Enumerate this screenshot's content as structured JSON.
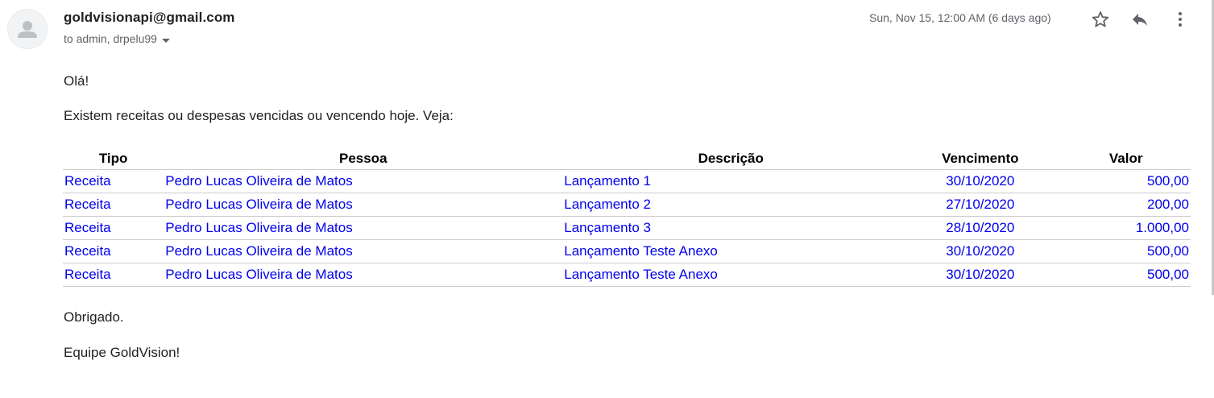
{
  "email": {
    "sender": "goldvisionapi@gmail.com",
    "recipients": "to admin, drpelu99",
    "date": "Sun, Nov 15, 12:00 AM (6 days ago)",
    "icons": {
      "avatar": "person-avatar-icon",
      "star": "star-outline-icon",
      "reply": "reply-icon",
      "more": "more-vertical-icon",
      "caret": "caret-down-icon"
    }
  },
  "body": {
    "greeting": "Olá!",
    "intro": "Existem receitas ou despesas vencidas ou vencendo hoje. Veja:",
    "thanks": "Obrigado.",
    "signature": "Equipe GoldVision!"
  },
  "table": {
    "headers": {
      "tipo": "Tipo",
      "pessoa": "Pessoa",
      "descricao": "Descrição",
      "vencimento": "Vencimento",
      "valor": "Valor"
    },
    "rows": [
      {
        "tipo": "Receita",
        "pessoa": "Pedro Lucas Oliveira de Matos",
        "descricao": "Lançamento 1",
        "vencimento": "30/10/2020",
        "valor": "500,00"
      },
      {
        "tipo": "Receita",
        "pessoa": "Pedro Lucas Oliveira de Matos",
        "descricao": "Lançamento 2",
        "vencimento": "27/10/2020",
        "valor": "200,00"
      },
      {
        "tipo": "Receita",
        "pessoa": "Pedro Lucas Oliveira de Matos",
        "descricao": "Lançamento 3",
        "vencimento": "28/10/2020",
        "valor": "1.000,00"
      },
      {
        "tipo": "Receita",
        "pessoa": "Pedro Lucas Oliveira de Matos",
        "descricao": "Lançamento Teste Anexo",
        "vencimento": "30/10/2020",
        "valor": "500,00"
      },
      {
        "tipo": "Receita",
        "pessoa": "Pedro Lucas Oliveira de Matos",
        "descricao": "Lançamento Teste Anexo",
        "vencimento": "30/10/2020",
        "valor": "500,00"
      }
    ]
  },
  "colors": {
    "link": "#0000ee",
    "text": "#202124",
    "muted": "#5f6368",
    "divider": "#cccccc"
  }
}
